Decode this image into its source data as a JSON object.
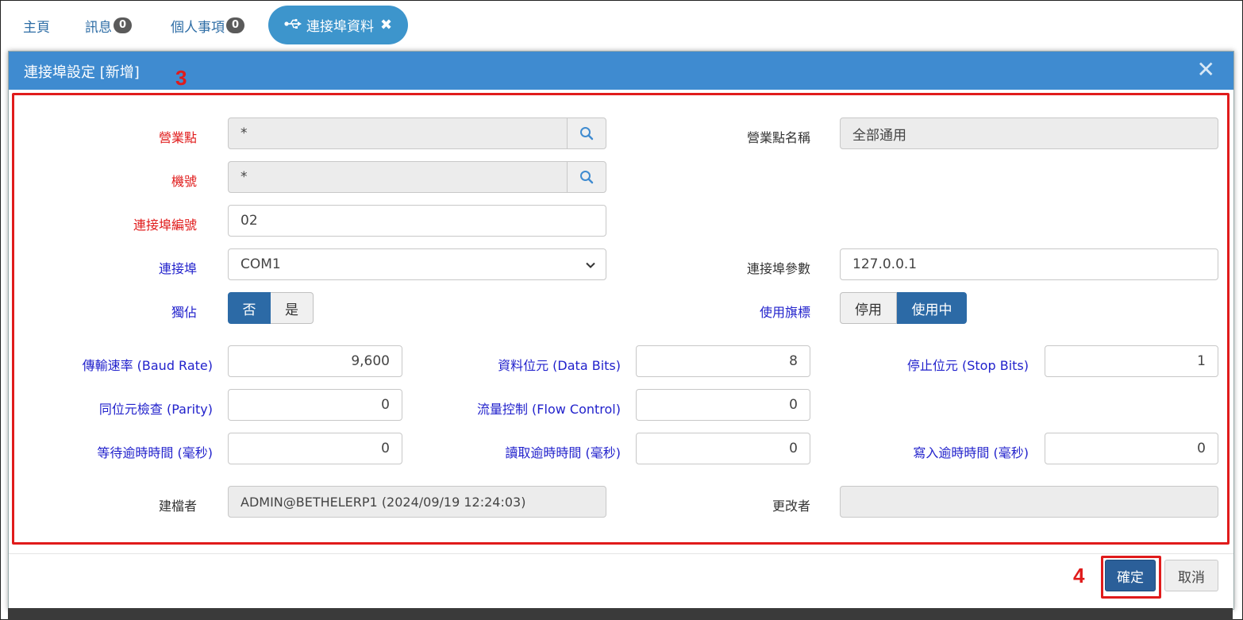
{
  "tabs": [
    {
      "label": "主頁"
    },
    {
      "label": "訊息",
      "badge": "0"
    },
    {
      "label": "個人事項",
      "badge": "0"
    }
  ],
  "active_tab": {
    "icon": "usb-icon",
    "label": "連接埠資料",
    "close_icon": "close-icon"
  },
  "modal": {
    "title": "連接埠設定 [新增]",
    "close_label": "✕",
    "callout_form": "3",
    "callout_confirm": "4"
  },
  "form": {
    "site": {
      "label": "營業點",
      "value": "*"
    },
    "site_name": {
      "label": "營業點名稱",
      "value": "全部通用"
    },
    "machine": {
      "label": "機號",
      "value": "*"
    },
    "port_no": {
      "label": "連接埠編號",
      "value": "02"
    },
    "port": {
      "label": "連接埠",
      "value": "COM1"
    },
    "port_params": {
      "label": "連接埠參數",
      "value": "127.0.0.1"
    },
    "exclusive": {
      "label": "獨佔",
      "options": [
        "否",
        "是"
      ],
      "selected": "否"
    },
    "active_flag": {
      "label": "使用旗標",
      "options": [
        "停用",
        "使用中"
      ],
      "selected": "使用中"
    },
    "baud_rate": {
      "label": "傳輸速率 (Baud Rate)",
      "value": "9,600"
    },
    "data_bits": {
      "label": "資料位元 (Data Bits)",
      "value": "8"
    },
    "stop_bits": {
      "label": "停止位元 (Stop Bits)",
      "value": "1"
    },
    "parity": {
      "label": "同位元檢查 (Parity)",
      "value": "0"
    },
    "flow_control": {
      "label": "流量控制 (Flow Control)",
      "value": "0"
    },
    "wait_timeout": {
      "label": "等待逾時時間 (毫秒)",
      "value": "0"
    },
    "read_timeout": {
      "label": "讀取逾時時間 (毫秒)",
      "value": "0"
    },
    "write_timeout": {
      "label": "寫入逾時時間 (毫秒)",
      "value": "0"
    },
    "created_by": {
      "label": "建檔者",
      "value": "ADMIN@BETHELERP1 (2024/09/19 12:24:03)"
    },
    "modified_by": {
      "label": "更改者",
      "value": ""
    }
  },
  "footer": {
    "confirm_label": "確定",
    "cancel_label": "取消"
  },
  "colors": {
    "header": "#3f8bd0",
    "active_tab": "#3d95cc",
    "required": "#e01b1b",
    "label_blue": "#2222cc",
    "primary_button": "#2b5f99",
    "callout": "#e01b1b"
  }
}
